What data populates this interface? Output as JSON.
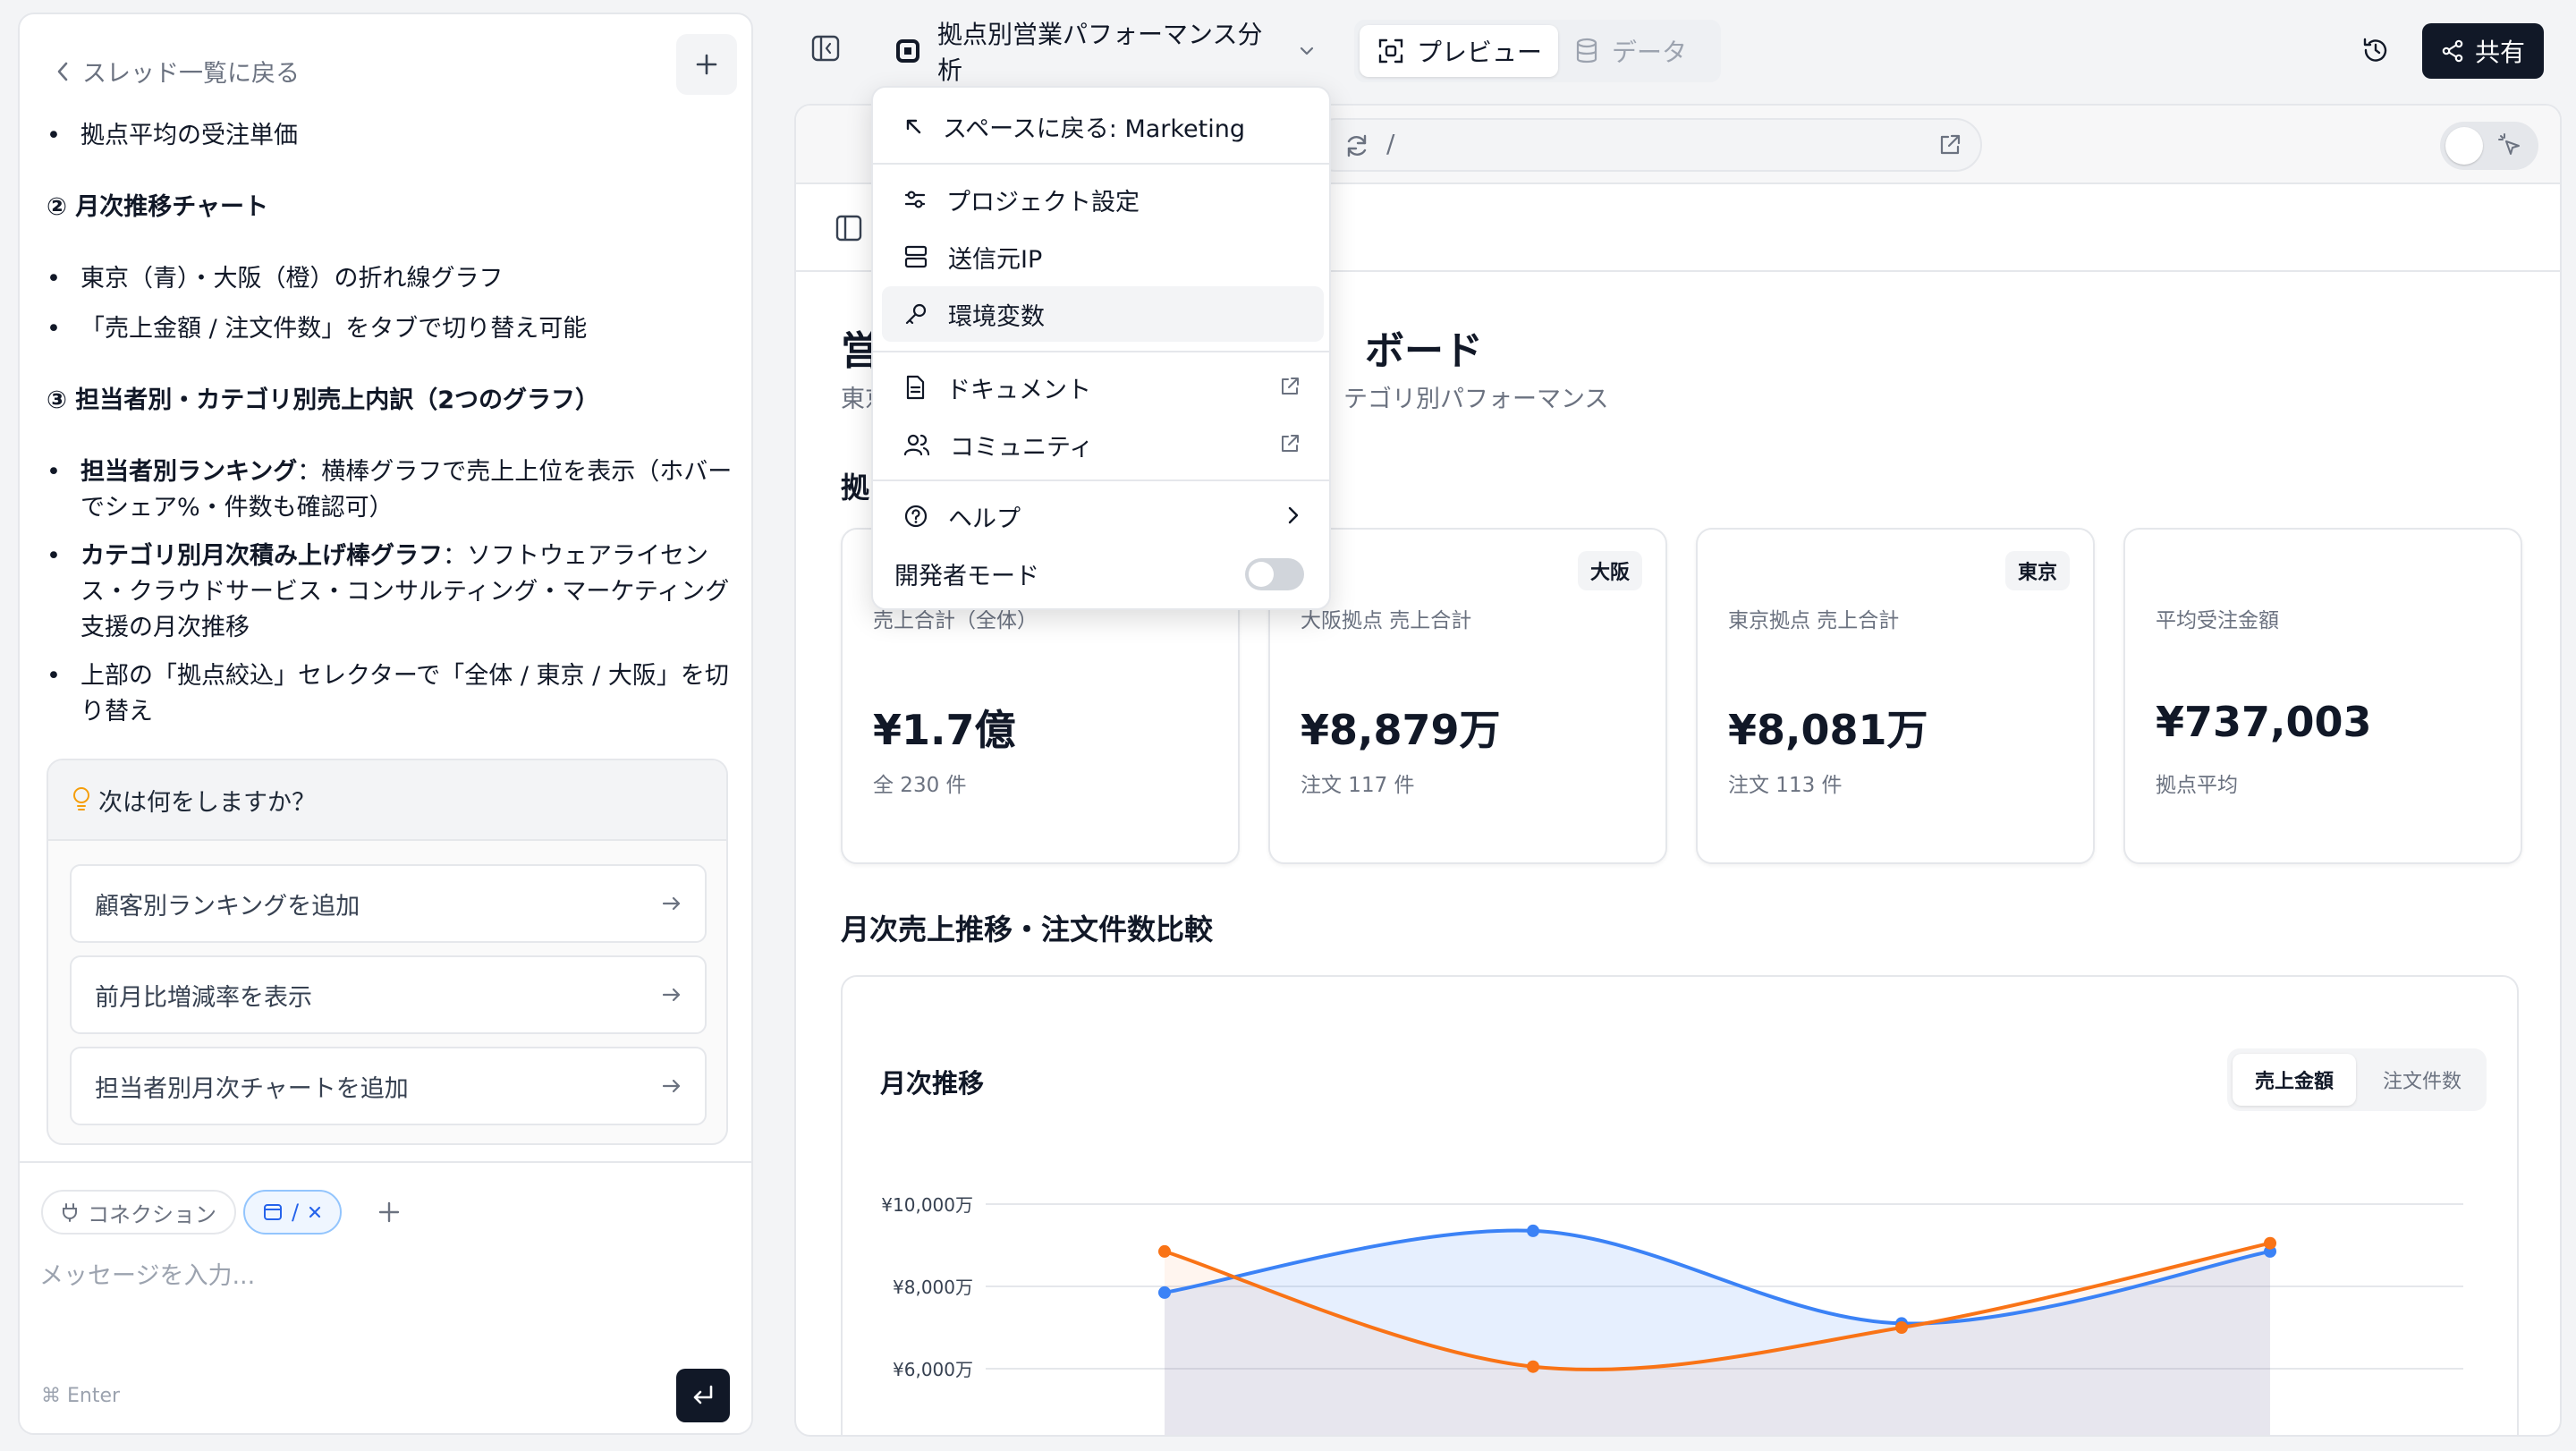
{
  "sidebar": {
    "back_label": "スレッド一覧に戻る",
    "chat": {
      "b1": "拠点平均の受注単価",
      "h2": "② 月次推移チャート",
      "b2": "東京（青）・大阪（橙）の折れ線グラフ",
      "b3": "「売上金額 / 注文件数」をタブで切り替え可能",
      "h3": "③ 担当者別・カテゴリ別売上内訳（2つのグラフ）",
      "b4_bold": "担当者別ランキング",
      "b4_rest": "：横棒グラフで売上上位を表示（ホバーでシェア%・件数も確認可）",
      "b5_bold": "カテゴリ別月次積み上げ棒グラフ",
      "b5_rest": "：ソフトウェアライセンス・クラウドサービス・コンサルティング・マーケティング支援の月次推移",
      "b6": "上部の「拠点絞込」セレクターで「全体 / 東京 / 大阪」を切り替え"
    },
    "next_title": "次は何をしますか？",
    "suggestions": [
      "顧客別ランキングを追加",
      "前月比増減率を表示",
      "担当者別月次チャートを追加"
    ],
    "composer": {
      "chip_connection": "コネクション",
      "chip_path": "/",
      "placeholder": "メッセージを入力...",
      "hint": "⌘ Enter"
    }
  },
  "toolbar": {
    "project_name": "拠点別営業パフォーマンス分析",
    "tab_preview": "プレビュー",
    "tab_data": "データ",
    "share_label": "共有"
  },
  "preview": {
    "url_path": "/",
    "title_a": "営",
    "title_b": "ボード",
    "subtitle_a": "東京",
    "subtitle_b": "テゴリ別パフォーマンス",
    "section1": "拠",
    "kpis": [
      {
        "label": "売上合計（全体）",
        "value": "¥1.7億",
        "sub": "全 230 件",
        "badge": ""
      },
      {
        "label": "大阪拠点 売上合計",
        "value": "¥8,879万",
        "sub": "注文 117 件",
        "badge": "大阪"
      },
      {
        "label": "東京拠点 売上合計",
        "value": "¥8,081万",
        "sub": "注文 113 件",
        "badge": "東京"
      },
      {
        "label": "平均受注金額",
        "value": "¥737,003",
        "sub": "拠点平均",
        "badge": ""
      }
    ],
    "section2": "月次売上推移・注文件数比較",
    "chart_card_title": "月次推移",
    "chart_tab_on": "売上金額",
    "chart_tab_off": "注文件数"
  },
  "menu": {
    "back_space": "スペースに戻る: Marketing",
    "project_settings": "プロジェクト設定",
    "source_ip": "送信元IP",
    "env_vars": "環境変数",
    "docs": "ドキュメント",
    "community": "コミュニティ",
    "help": "ヘルプ",
    "dev_mode": "開発者モード"
  },
  "chart_data": {
    "type": "line",
    "ytick_labels": [
      "¥10,000万",
      "¥8,000万",
      "¥6,000万"
    ],
    "yticks": [
      10000,
      8000,
      6000
    ],
    "ylim": [
      6000,
      10000
    ],
    "series": [
      {
        "color": "#3b82f6",
        "values": [
          7850,
          9350,
          7100,
          8850
        ]
      },
      {
        "color": "#f97316",
        "values": [
          8850,
          6050,
          7000,
          9050
        ]
      }
    ],
    "grid": true
  }
}
